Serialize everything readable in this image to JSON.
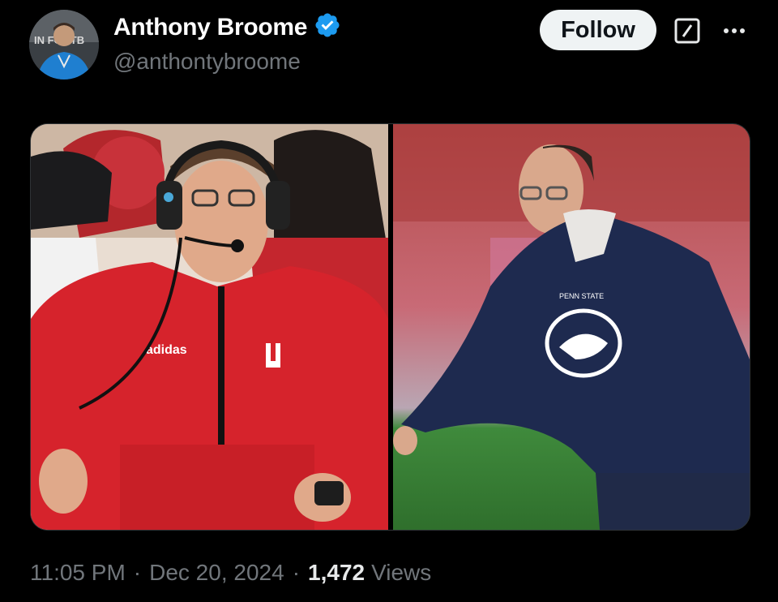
{
  "author": {
    "display_name": "Anthony Broome",
    "handle": "@anthontybroome",
    "verified": true
  },
  "actions": {
    "follow_label": "Follow",
    "grok_icon": "grok-icon",
    "more_icon": "more-options-icon"
  },
  "media": {
    "left_image": "coach-in-red-jacket-with-headset",
    "right_image": "coach-in-navy-hoodie-on-field",
    "left_logo_text": "adidas"
  },
  "meta": {
    "time": "11:05 PM",
    "separator": "·",
    "date": "Dec 20, 2024",
    "views_count": "1,472",
    "views_label": "Views"
  },
  "colors": {
    "background": "#000000",
    "verified_blue": "#1d9bf0",
    "follow_bg": "#eff3f4",
    "secondary_text": "#71767b"
  }
}
